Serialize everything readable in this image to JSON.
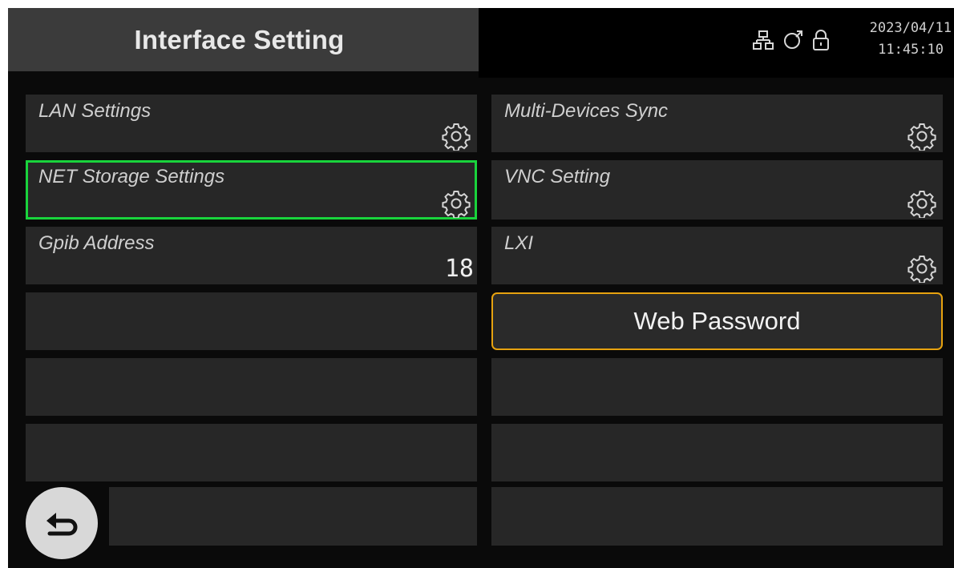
{
  "header": {
    "title": "Interface Setting",
    "date": "2023/04/11",
    "time": "11:45:10",
    "status_icons": [
      "network-icon",
      "usb-sync-icon",
      "lock-icon"
    ]
  },
  "left_column": [
    {
      "label": "LAN Settings",
      "icon": "gear-icon"
    },
    {
      "label": "NET Storage Settings",
      "icon": "gear-icon",
      "selected": true
    },
    {
      "label": "Gpib Address",
      "value": "18"
    },
    {
      "label": ""
    },
    {
      "label": ""
    },
    {
      "label": ""
    },
    {
      "label": ""
    }
  ],
  "right_column": [
    {
      "label": "Multi-Devices Sync",
      "icon": "gear-icon"
    },
    {
      "label": "VNC Setting",
      "icon": "gear-icon"
    },
    {
      "label": "LXI",
      "icon": "gear-icon"
    },
    {
      "label": "Web Password",
      "type": "button"
    },
    {
      "label": ""
    },
    {
      "label": ""
    },
    {
      "label": ""
    }
  ],
  "back_button": {
    "icon": "back-arrow-icon"
  },
  "colors": {
    "selected_border": "#19d33c",
    "button_border": "#e7a20f",
    "cell_bg": "#272727",
    "title_bg": "#3b3b3b"
  }
}
